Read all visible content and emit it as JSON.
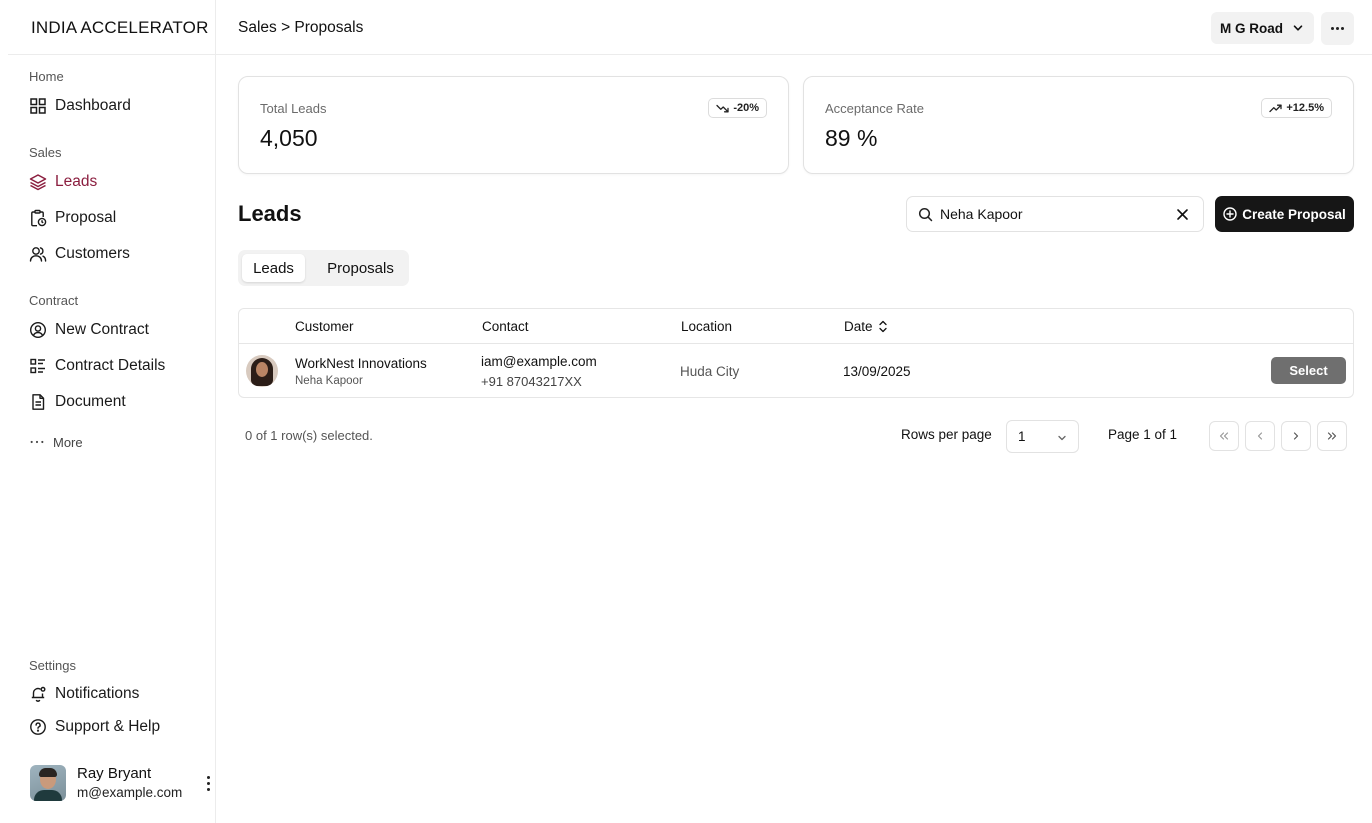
{
  "sidebar": {
    "brand": "INDIA ACCELERATOR",
    "sections": [
      {
        "label": "Home"
      },
      {
        "label": "Sales"
      },
      {
        "label": "Contract"
      },
      {
        "label": "Settings"
      }
    ],
    "items": {
      "dashboard": {
        "label": "Dashboard",
        "icon": "grid-icon"
      },
      "leads": {
        "label": "Leads",
        "icon": "layers-icon",
        "active": true
      },
      "proposal": {
        "label": "Proposal",
        "icon": "clipboard-clock-icon"
      },
      "customers": {
        "label": "Customers",
        "icon": "users-icon"
      },
      "new_contract": {
        "label": "New Contract",
        "icon": "user-circle-icon"
      },
      "contract_details": {
        "label": "Contract Details",
        "icon": "list-details-icon"
      },
      "document": {
        "label": "Document",
        "icon": "file-text-icon"
      },
      "more": {
        "label": "More",
        "icon": "ellipsis-icon"
      },
      "notifications": {
        "label": "Notifications",
        "icon": "bell-icon"
      },
      "support": {
        "label": "Support & Help",
        "icon": "help-circle-icon"
      }
    },
    "user": {
      "name": "Ray Bryant",
      "email": "m@example.com"
    }
  },
  "header": {
    "breadcrumb": "Sales > Proposals",
    "location": "M G Road"
  },
  "stats": [
    {
      "label": "Total Leads",
      "value": "4,050",
      "badge": "-20%",
      "trend": "down"
    },
    {
      "label": "Acceptance Rate",
      "value": "89 %",
      "badge": "+12.5%",
      "trend": "up"
    }
  ],
  "main": {
    "title": "Leads",
    "search": {
      "value": "Neha Kapoor",
      "placeholder": "Search"
    },
    "create_label": "Create Proposal",
    "tabs": [
      {
        "label": "Leads",
        "active": true
      },
      {
        "label": "Proposals",
        "active": false
      }
    ],
    "table": {
      "columns": [
        "Customer",
        "Contact",
        "Location",
        "Date"
      ],
      "rows": [
        {
          "company": "WorkNest Innovations",
          "person": "Neha Kapoor",
          "email": "iam@example.com",
          "phone": "+91 87043217XX",
          "location": "Huda City",
          "date": "13/09/2025",
          "action": "Select"
        }
      ]
    },
    "footer": {
      "selected": "0 of 1 row(s) selected.",
      "rows_per_page_label": "Rows per page",
      "rows_per_page": "1",
      "page": "Page 1 of 1"
    }
  },
  "colors": {
    "accent": "#8b1e3f",
    "primary_button": "#161616",
    "select_button": "#6f6f6f"
  }
}
